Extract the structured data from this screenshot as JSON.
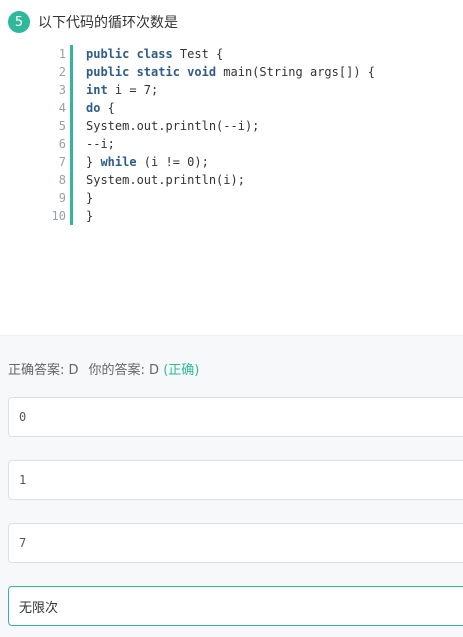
{
  "question": {
    "number": "5",
    "title": "以下代码的循环次数是"
  },
  "code": {
    "lines": [
      {
        "num": "1",
        "parts": [
          {
            "t": "public class",
            "kw": true
          },
          {
            "t": " Test {",
            "kw": false
          }
        ]
      },
      {
        "num": "2",
        "parts": [
          {
            "t": "public static void",
            "kw": true
          },
          {
            "t": " main(String args[]) {",
            "kw": false
          }
        ]
      },
      {
        "num": "3",
        "parts": [
          {
            "t": "int",
            "kw": true
          },
          {
            "t": " i = 7;",
            "kw": false
          }
        ]
      },
      {
        "num": "4",
        "parts": [
          {
            "t": "do",
            "kw": true
          },
          {
            "t": " {",
            "kw": false
          }
        ]
      },
      {
        "num": "5",
        "parts": [
          {
            "t": "System.out.println(--i);",
            "kw": false
          }
        ]
      },
      {
        "num": "6",
        "parts": [
          {
            "t": "--i;",
            "kw": false
          }
        ]
      },
      {
        "num": "7",
        "parts": [
          {
            "t": "} ",
            "kw": false
          },
          {
            "t": "while",
            "kw": true
          },
          {
            "t": " (i != 0);",
            "kw": false
          }
        ]
      },
      {
        "num": "8",
        "parts": [
          {
            "t": "System.out.println(i);",
            "kw": false
          }
        ]
      },
      {
        "num": "9",
        "parts": [
          {
            "t": "}",
            "kw": false
          }
        ]
      },
      {
        "num": "10",
        "parts": [
          {
            "t": "}",
            "kw": false
          }
        ]
      }
    ]
  },
  "answer": {
    "correct_label": "正确答案: D",
    "yours_label": "你的答案: D",
    "status": "(正确)"
  },
  "options": [
    {
      "text": "0",
      "selected": false
    },
    {
      "text": "1",
      "selected": false
    },
    {
      "text": "7",
      "selected": false
    },
    {
      "text": "无限次",
      "selected": true
    }
  ],
  "colors": {
    "accent": "#2fb99a",
    "keyword": "#2d5c8a"
  }
}
